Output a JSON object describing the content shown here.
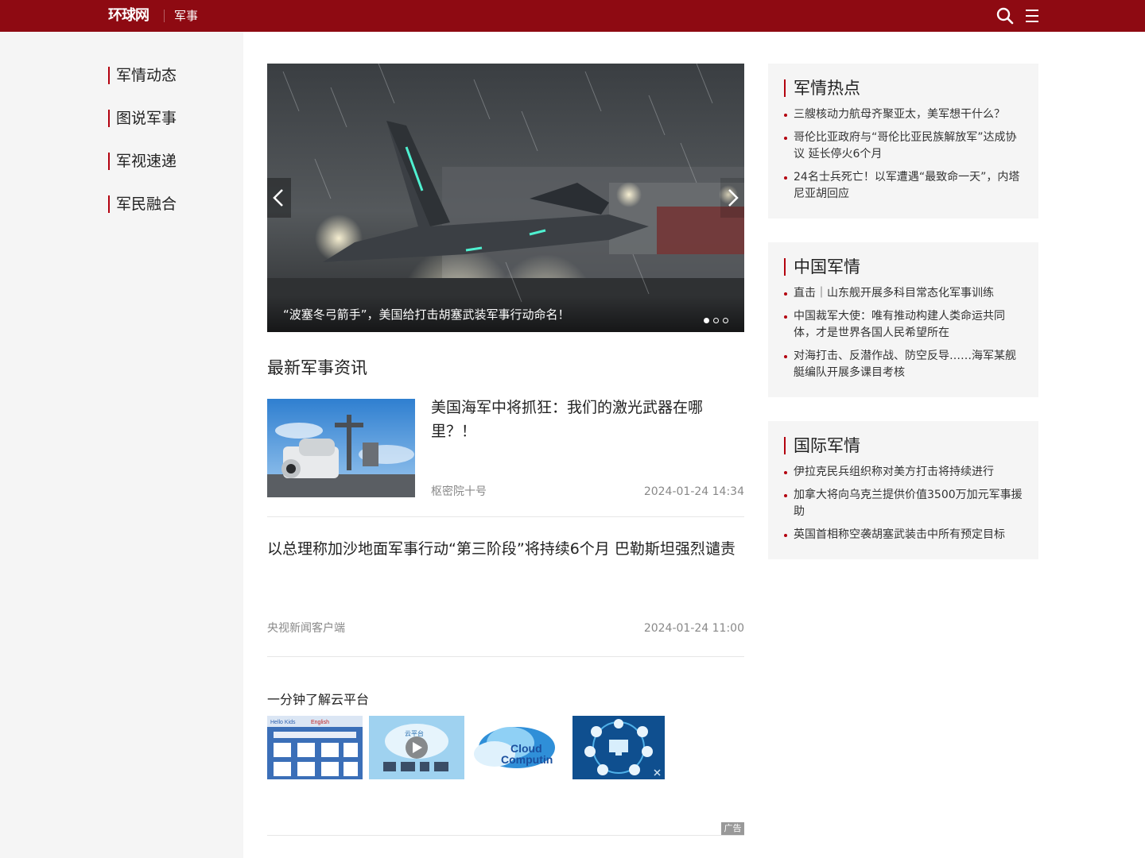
{
  "header": {
    "logo": "环球网",
    "channel": "军事"
  },
  "sidebar": {
    "items": [
      {
        "label": "军情动态"
      },
      {
        "label": "图说军事"
      },
      {
        "label": "军视速递"
      },
      {
        "label": "军民融合"
      }
    ]
  },
  "slider": {
    "caption": "“波塞冬弓箭手”，美国给打击胡塞武装军事行动命名！",
    "slide_count": 3,
    "active_index": 0
  },
  "latest": {
    "title": "最新军事资讯",
    "items": [
      {
        "title": "美国海军中将抓狂：我们的激光武器在哪里？！",
        "source": "枢密院十号",
        "time": "2024-01-24 14:34"
      },
      {
        "title": "以总理称加沙地面军事行动“第三阶段”将持续6个月 巴勒斯坦强烈谴责",
        "source": "央视新闻客户端",
        "time": "2024-01-24 11:00"
      }
    ]
  },
  "ad": {
    "title": "一分钟了解云平台",
    "label": "广告",
    "thumb_texts": [
      "Hello Kids",
      "English",
      "云平台",
      "Cloud",
      "Computin"
    ]
  },
  "panels": [
    {
      "title": "军情热点",
      "items": [
        "三艘核动力航母齐聚亚太，美军想干什么？",
        "哥伦比亚政府与“哥伦比亚民族解放军”达成协议 延长停火6个月",
        "24名士兵死亡！以军遭遇“最致命一天”，内塔尼亚胡回应"
      ]
    },
    {
      "title": "中国军情",
      "items": [
        "直击｜山东舰开展多科目常态化军事训练",
        "中国裁军大使：唯有推动构建人类命运共同体，才是世界各国人民希望所在",
        "对海打击、反潜作战、防空反导……海军某舰艇编队开展多课目考核"
      ]
    },
    {
      "title": "国际军情",
      "items": [
        "伊拉克民兵组织称对美方打击将持续进行",
        "加拿大将向乌克兰提供价值3500万加元军事援助",
        "英国首相称空袭胡塞武装击中所有预定目标"
      ]
    }
  ],
  "colors": {
    "brand": "#8e0a12",
    "accent": "#b3000f",
    "panel_bg": "#f5f5f5"
  },
  "icons": [
    "search-icon",
    "menu-icon",
    "chevron-left-icon",
    "chevron-right-icon",
    "play-icon",
    "close-icon"
  ]
}
